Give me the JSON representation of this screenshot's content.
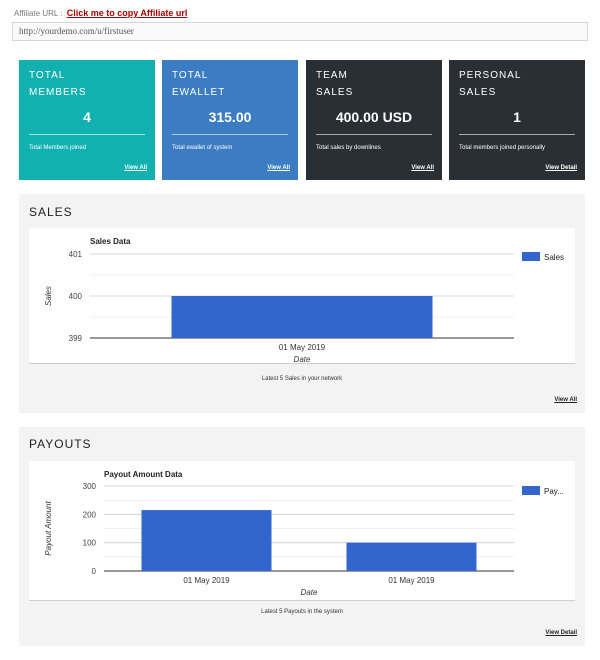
{
  "affiliate": {
    "label": "Affiliate URL :",
    "copy_link": "Click me to copy Affiliate url",
    "url": "http://yourdemo.com/u/firstuser"
  },
  "cards": [
    {
      "title_line1": "TOTAL",
      "title_line2": "MEMBERS",
      "value": "4",
      "description": "Total Members joined",
      "link": "View All",
      "color": "#12b1b0"
    },
    {
      "title_line1": "TOTAL",
      "title_line2": "EWALLET",
      "value": "315.00",
      "description": "Total ewallet of system",
      "link": "View All",
      "color": "#3b7cc2"
    },
    {
      "title_line1": "TEAM",
      "title_line2": "SALES",
      "value": "400.00 USD",
      "description": "Total sales by downlines",
      "link": "View All",
      "color": "#2a2f35"
    },
    {
      "title_line1": "PERSONAL",
      "title_line2": "SALES",
      "value": "1",
      "description": "Total members joined personally",
      "link": "View Detail",
      "color": "#2a2f35"
    }
  ],
  "sales_panel": {
    "heading": "SALES",
    "footer_text": "Latest 5 Sales in your network",
    "footer_link": "View All"
  },
  "payouts_panel": {
    "heading": "PAYOUTS",
    "footer_text": "Latest 5 Payouts in the system",
    "footer_link": "View Detail"
  },
  "chart_data": [
    {
      "type": "bar",
      "title": "Sales Data",
      "xlabel": "Date",
      "ylabel": "Sales",
      "categories": [
        "01 May 2019"
      ],
      "series": [
        {
          "name": "Sales",
          "values": [
            400
          ],
          "color": "#3366cc"
        }
      ],
      "ylim": [
        399,
        401
      ],
      "yticks": [
        399,
        400,
        401
      ],
      "grid": true,
      "legend": "right"
    },
    {
      "type": "bar",
      "title": "Payout Amount Data",
      "xlabel": "Date",
      "ylabel": "Payout Amount",
      "categories": [
        "01 May 2019",
        "01 May 2019"
      ],
      "series": [
        {
          "name": "Pay...",
          "values": [
            215,
            100
          ],
          "color": "#3366cc"
        }
      ],
      "ylim": [
        0,
        300
      ],
      "yticks": [
        0,
        100,
        200,
        300
      ],
      "grid": true,
      "legend": "right"
    }
  ]
}
